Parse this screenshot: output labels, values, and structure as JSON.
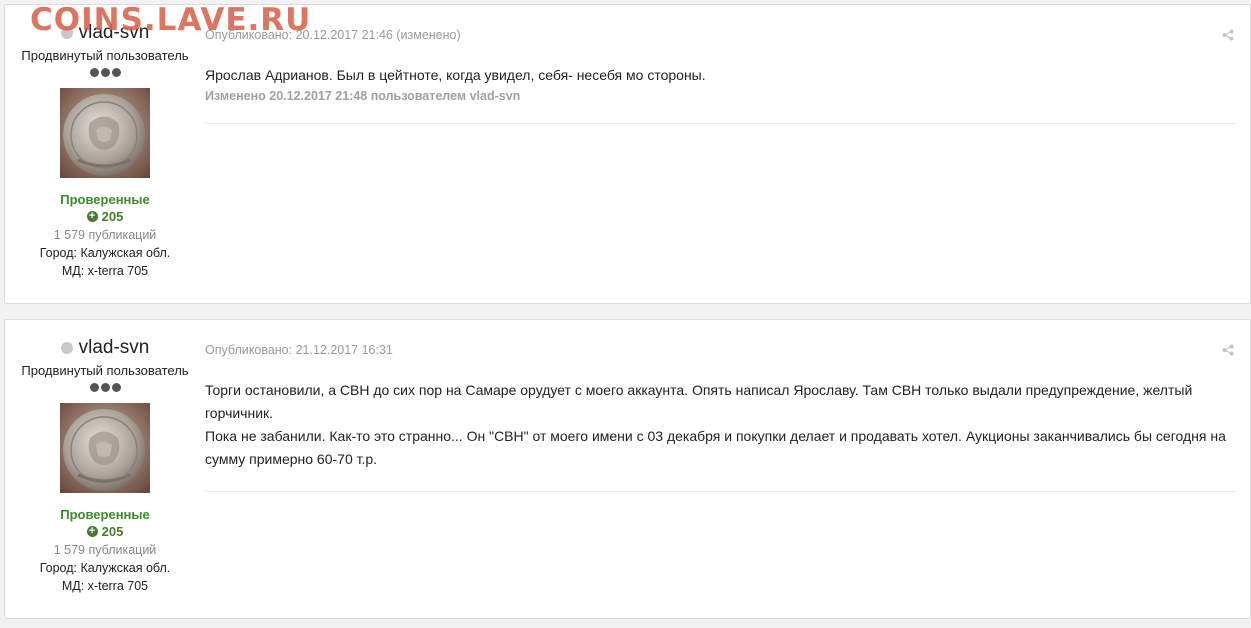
{
  "watermark": "COINS.LAVE.RU",
  "posts": [
    {
      "author": {
        "name": "vlad-svn",
        "role": "Продвинутый пользователь",
        "group": "Проверенные",
        "reputation": "205",
        "post_count": "1 579 публикаций",
        "city": "Город: Калужская обл.",
        "md": "МД: x-terra 705"
      },
      "meta": "Опубликовано: 20.12.2017 21:46 (изменено)",
      "lines": [
        "Ярослав Адрианов. Был в цейтноте, когда увидел, себя- несебя мо стороны."
      ],
      "edited": "Изменено 20.12.2017 21:48 пользователем vlad-svn"
    },
    {
      "author": {
        "name": "vlad-svn",
        "role": "Продвинутый пользователь",
        "group": "Проверенные",
        "reputation": "205",
        "post_count": "1 579 публикаций",
        "city": "Город: Калужская обл.",
        "md": "МД: x-terra 705"
      },
      "meta": "Опубликовано: 21.12.2017 16:31",
      "lines": [
        "Торги остановили, а СВН до сих пор на Самаре орудует с моего аккаунта. Опять написал Ярославу. Там СВН только выдали предупреждение, желтый",
        "горчичник.",
        "Пока не забанили. Как-то это странно... Он \"СВН\" от моего имени с 03 декабря и покупки делает и продавать хотел. Аукционы заканчивались бы сегодня на",
        "сумму примерно 60-70 т.р."
      ]
    }
  ],
  "colors": {
    "watermark": "#d9624c",
    "group": "#3d8b2b",
    "reputation": "#4a7a32",
    "background": "#f2f2f2"
  },
  "icons": [
    "online-status-icon",
    "rank-pips-icon",
    "reputation-plus-icon",
    "share-icon"
  ]
}
